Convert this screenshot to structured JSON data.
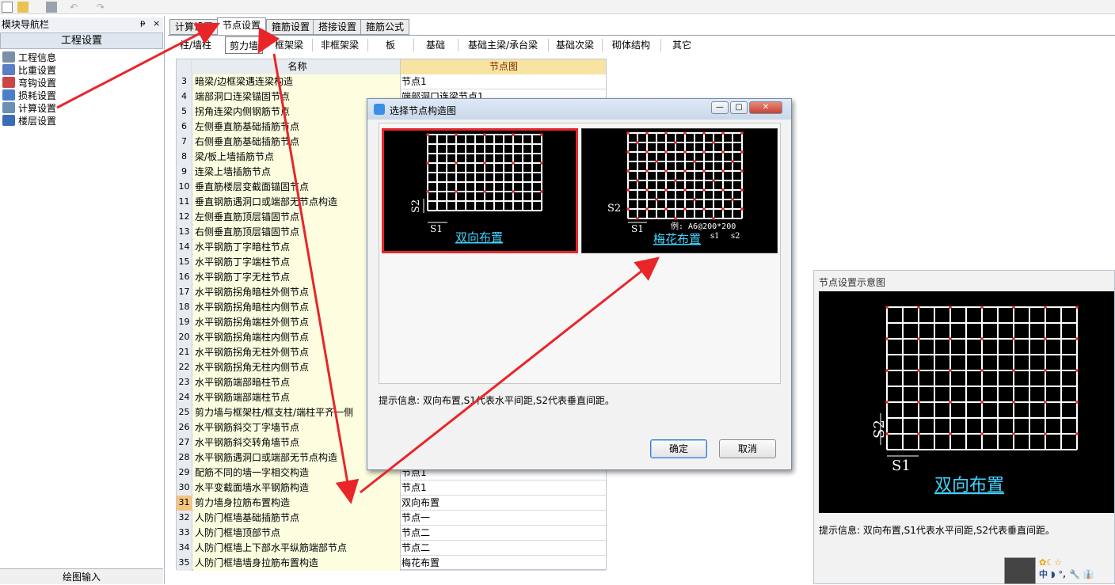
{
  "nav": {
    "title": "模块导航栏",
    "pin": "ᵽ",
    "close": "×",
    "section_header": "工程设置",
    "items": [
      {
        "label": "工程信息",
        "icon": "info-icon"
      },
      {
        "label": "比重设置",
        "icon": "weight-icon"
      },
      {
        "label": "弯钩设置",
        "icon": "hook-icon"
      },
      {
        "label": "损耗设置",
        "icon": "loss-icon"
      },
      {
        "label": "计算设置",
        "icon": "calc-icon"
      },
      {
        "label": "楼层设置",
        "icon": "floor-icon"
      }
    ],
    "bottom_tab": "绘图输入"
  },
  "main_tabs": [
    "计算设置",
    "节点设置",
    "箍筋设置",
    "搭接设置",
    "箍筋公式"
  ],
  "active_main_tab": "节点设置",
  "sub_tabs": [
    "柱/墙柱",
    "剪力墙",
    "框架梁",
    "非框架梁",
    "板",
    "基础",
    "基础主梁/承台梁",
    "基础次梁",
    "砌体结构",
    "其它"
  ],
  "active_sub_tab": "剪力墙",
  "grid": {
    "headers": {
      "name": "名称",
      "value": "节点图"
    },
    "rows": [
      {
        "idx": "3",
        "name": "暗梁/边框梁遇连梁构造",
        "value": "节点1"
      },
      {
        "idx": "4",
        "name": "端部洞口连梁锚固节点",
        "value": "端部洞口连梁节点1"
      },
      {
        "idx": "5",
        "name": "拐角连梁内侧钢筋节点",
        "value": ""
      },
      {
        "idx": "6",
        "name": "左侧垂直筋基础插筋节点",
        "value": ""
      },
      {
        "idx": "7",
        "name": "右侧垂直筋基础插筋节点",
        "value": ""
      },
      {
        "idx": "8",
        "name": "梁/板上墙插筋节点",
        "value": ""
      },
      {
        "idx": "9",
        "name": "连梁上墙插筋节点",
        "value": ""
      },
      {
        "idx": "10",
        "name": "垂直筋楼层变截面锚固节点",
        "value": ""
      },
      {
        "idx": "11",
        "name": "垂直钢筋遇洞口或端部无节点构造",
        "value": ""
      },
      {
        "idx": "12",
        "name": "左侧垂直筋顶层锚固节点",
        "value": ""
      },
      {
        "idx": "13",
        "name": "右侧垂直筋顶层锚固节点",
        "value": ""
      },
      {
        "idx": "14",
        "name": "水平钢筋丁字暗柱节点",
        "value": ""
      },
      {
        "idx": "15",
        "name": "水平钢筋丁字端柱节点",
        "value": ""
      },
      {
        "idx": "16",
        "name": "水平钢筋丁字无柱节点",
        "value": ""
      },
      {
        "idx": "17",
        "name": "水平钢筋拐角暗柱外侧节点",
        "value": ""
      },
      {
        "idx": "18",
        "name": "水平钢筋拐角暗柱内侧节点",
        "value": ""
      },
      {
        "idx": "19",
        "name": "水平钢筋拐角端柱外侧节点",
        "value": ""
      },
      {
        "idx": "20",
        "name": "水平钢筋拐角端柱内侧节点",
        "value": ""
      },
      {
        "idx": "21",
        "name": "水平钢筋拐角无柱外侧节点",
        "value": ""
      },
      {
        "idx": "22",
        "name": "水平钢筋拐角无柱内侧节点",
        "value": ""
      },
      {
        "idx": "23",
        "name": "水平钢筋端部暗柱节点",
        "value": ""
      },
      {
        "idx": "24",
        "name": "水平钢筋端部端柱节点",
        "value": ""
      },
      {
        "idx": "25",
        "name": "剪力墙与框架柱/框支柱/端柱平齐一侧",
        "value": ""
      },
      {
        "idx": "26",
        "name": "水平钢筋斜交丁字墙节点",
        "value": ""
      },
      {
        "idx": "27",
        "name": "水平钢筋斜交转角墙节点",
        "value": ""
      },
      {
        "idx": "28",
        "name": "水平钢筋遇洞口或端部无节点构造",
        "value": ""
      },
      {
        "idx": "29",
        "name": "配筋不同的墙一字相交构造",
        "value": "节点1"
      },
      {
        "idx": "30",
        "name": "水平变截面墙水平钢筋构造",
        "value": "节点1"
      },
      {
        "idx": "31",
        "name": "剪力墙身拉筋布置构造",
        "value": "双向布置"
      },
      {
        "idx": "32",
        "name": "人防门框墙基础插筋节点",
        "value": "节点一"
      },
      {
        "idx": "33",
        "name": "人防门框墙顶部节点",
        "value": "节点二"
      },
      {
        "idx": "34",
        "name": "人防门框墙上下部水平纵筋端部节点",
        "value": "节点二"
      },
      {
        "idx": "35",
        "name": "人防门框墙墙身拉筋布置构造",
        "value": "梅花布置"
      }
    ],
    "selected_idx": "31",
    "dots_label": "···"
  },
  "dialog": {
    "title": "选择节点构造图",
    "options": [
      {
        "caption": "双向布置",
        "s1": "S1",
        "s2": "S2",
        "example": ""
      },
      {
        "caption": "梅花布置",
        "s1": "S1",
        "s2": "S2",
        "example": "例: A6@200*200",
        "ex_s1": "s1",
        "ex_s2": "s2"
      }
    ],
    "hint": "提示信息:  双向布置,S1代表水平间距,S2代表垂直间距。",
    "ok": "确定",
    "cancel": "取消",
    "minimize": "—",
    "restore": "▢",
    "close": "✕"
  },
  "preview": {
    "title": "节点设置示意图",
    "caption": "双向布置",
    "s1": "S1",
    "s2": "S2",
    "hint": "提示信息:  双向布置,S1代表水平间距,S2代表垂直间距。"
  },
  "tray": {
    "text": "中 ◗ °, 🔧 👔"
  },
  "colors": {
    "accent_red": "#e8262a",
    "grid_header": "#f8e4a2",
    "name_cell": "#fdfde0",
    "caption_cyan": "#3fd3ff"
  }
}
